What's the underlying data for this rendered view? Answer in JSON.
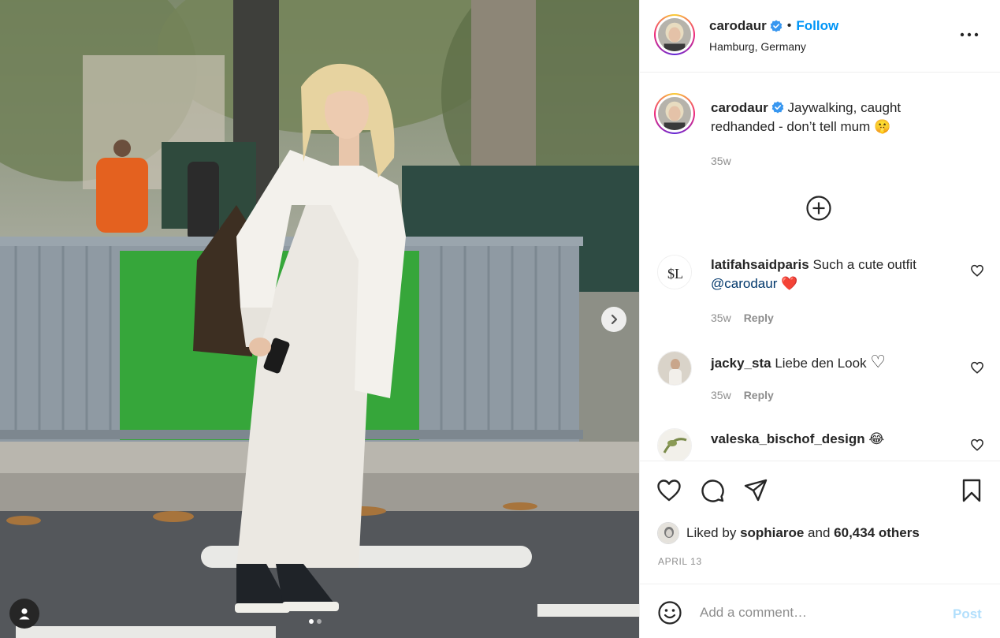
{
  "post": {
    "author": "carodaur",
    "follow_label": "Follow",
    "separator": "•",
    "location": "Hamburg, Germany",
    "more_icon": "more-horizontal-icon",
    "image_alt_icons": [
      "chevron-right-icon",
      "user-tag-icon"
    ],
    "carousel": {
      "count": 2,
      "active": 1
    }
  },
  "caption": {
    "username": "carodaur",
    "text_line1": "Jaywalking, caught",
    "text_line2": "redhanded - don’t tell mum",
    "emoji": "🤫",
    "time": "35w"
  },
  "comments": [
    {
      "username": "latifahsaidparis",
      "text": "Such a cute outfit",
      "mention": "@carodaur",
      "emoji": "❤️",
      "time": "35w",
      "reply": "Reply",
      "avatar_text": "$L"
    },
    {
      "username": "jacky_sta",
      "text": "Liebe den Look",
      "emoji": "♡",
      "time": "35w",
      "reply": "Reply"
    },
    {
      "username": "valeska_bischof_design",
      "text": "",
      "emoji": "😂"
    }
  ],
  "likes": {
    "prefix": "Liked by",
    "user": "sophiaroe",
    "conj": "and",
    "others": "60,434 others"
  },
  "date": "APRIL 13",
  "add_comment": {
    "placeholder": "Add a comment…",
    "post_label": "Post"
  },
  "colors": {
    "link": "#0095f6",
    "mention": "#00376b",
    "muted": "#8e8e8e",
    "post_disabled": "#b2dffc",
    "heart_red": "#ed4956"
  }
}
